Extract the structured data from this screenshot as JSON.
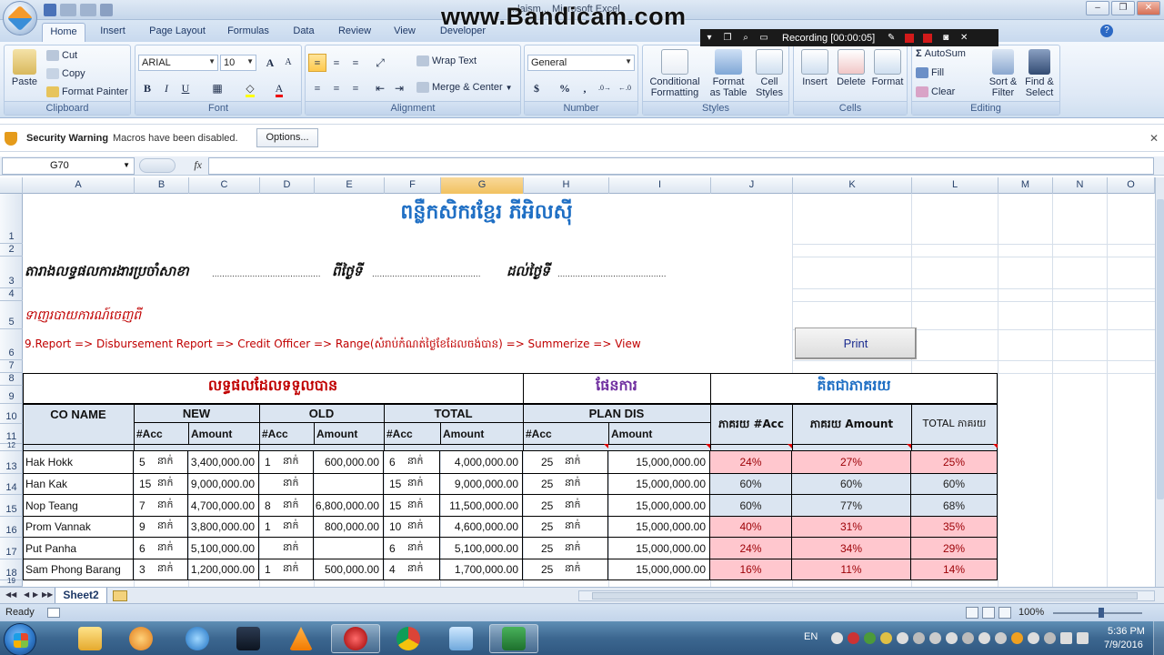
{
  "window": {
    "title": "...laism... Microsoft Excel",
    "watermark": "www.Bandicam.com"
  },
  "recorder": {
    "status": "Recording [00:00:05]"
  },
  "tabs": [
    "Home",
    "Insert",
    "Page Layout",
    "Formulas",
    "Data",
    "Review",
    "View",
    "Developer"
  ],
  "ribbon": {
    "clipboard": {
      "paste": "Paste",
      "cut": "Cut",
      "copy": "Copy",
      "format_painter": "Format Painter",
      "label": "Clipboard"
    },
    "font": {
      "name": "ARIAL",
      "size": "10",
      "bold": "B",
      "italic": "I",
      "underline": "U",
      "label": "Font"
    },
    "alignment": {
      "wrap_text": "Wrap Text",
      "merge_center": "Merge & Center",
      "label": "Alignment"
    },
    "number": {
      "format": "General",
      "currency": "$",
      "percent": "%",
      "comma": ",",
      "label": "Number"
    },
    "styles": {
      "conditional": "Conditional",
      "formatting": "Formatting",
      "format": "Format",
      "as_table": "as Table",
      "cell": "Cell",
      "cell_styles": "Styles",
      "label": "Styles"
    },
    "cells": {
      "insert": "Insert",
      "delete": "Delete",
      "format": "Format",
      "label": "Cells"
    },
    "editing": {
      "autosum": "AutoSum",
      "fill": "Fill",
      "clear": "Clear",
      "sort": "Sort &",
      "filter": "Filter",
      "find": "Find &",
      "select": "Select",
      "label": "Editing"
    }
  },
  "security": {
    "title": "Security Warning",
    "message": "Macros have been disabled.",
    "options": "Options..."
  },
  "formula_bar": {
    "name_box": "G70",
    "fx": "fx",
    "value": ""
  },
  "columns": [
    "A",
    "B",
    "C",
    "D",
    "E",
    "F",
    "G",
    "H",
    "I",
    "J",
    "K",
    "L",
    "M",
    "N",
    "O"
  ],
  "rows": [
    "1",
    "2",
    "3",
    "4",
    "5",
    "6",
    "7",
    "8",
    "9",
    "10",
    "11",
    "12",
    "13",
    "14",
    "15",
    "16",
    "17",
    "18",
    "19"
  ],
  "sheet": {
    "title": "ពន្លឺកសិករខ្មែរ ភីអិលស៊ី",
    "report_line": "តារាងលទ្ធផលការងារប្រចាំសាខា",
    "from_label": "ពីថ្ងៃទី",
    "to_label": "ដល់ថ្ងៃទី",
    "dots": "...........................................",
    "note_label": "ទាញរបាយការណ៍ចេញពី",
    "path": "9.Report => Disbursement Report => Credit Officer => Range(សំរាប់កំណត់ថ្ងៃខែដែលចង់បាន) => Summerize => View",
    "print_button": "Print",
    "section_result": "លទ្ធផលដែលទទួលបាន",
    "section_plan": "ផែនការ",
    "section_pct": "គិតជាភាគរយ",
    "hdr_coname": "CO NAME",
    "hdr_new": "NEW",
    "hdr_old": "OLD",
    "hdr_total": "TOTAL",
    "hdr_plandis": "PLAN DIS",
    "hdr_acc": "#Acc",
    "hdr_amount": "Amount",
    "hdr_pct_acc": "ភាគរយ #Acc",
    "hdr_pct_amount": "ភាគរយ Amount",
    "hdr_pct_total": "TOTAL ភាគរយ",
    "unit": "នាក់",
    "rows": [
      {
        "name": "Hak Hokk",
        "new_acc": "5",
        "new_amt": "3,400,000.00",
        "old_acc": "1",
        "old_amt": "600,000.00",
        "tot_acc": "6",
        "tot_amt": "4,000,000.00",
        "plan_acc": "25",
        "plan_amt": "15,000,000.00",
        "pct_acc": "24%",
        "pct_amt": "27%",
        "pct_tot": "25%",
        "pink": true
      },
      {
        "name": "Han Kak",
        "new_acc": "15",
        "new_amt": "9,000,000.00",
        "old_acc": "",
        "old_amt": "",
        "tot_acc": "15",
        "tot_amt": "9,000,000.00",
        "plan_acc": "25",
        "plan_amt": "15,000,000.00",
        "pct_acc": "60%",
        "pct_amt": "60%",
        "pct_tot": "60%",
        "pink": false
      },
      {
        "name": "Nop Teang",
        "new_acc": "7",
        "new_amt": "4,700,000.00",
        "old_acc": "8",
        "old_amt": "6,800,000.00",
        "tot_acc": "15",
        "tot_amt": "11,500,000.00",
        "plan_acc": "25",
        "plan_amt": "15,000,000.00",
        "pct_acc": "60%",
        "pct_amt": "77%",
        "pct_tot": "68%",
        "pink": false
      },
      {
        "name": "Prom Vannak",
        "new_acc": "9",
        "new_amt": "3,800,000.00",
        "old_acc": "1",
        "old_amt": "800,000.00",
        "tot_acc": "10",
        "tot_amt": "4,600,000.00",
        "plan_acc": "25",
        "plan_amt": "15,000,000.00",
        "pct_acc": "40%",
        "pct_amt": "31%",
        "pct_tot": "35%",
        "pink": true
      },
      {
        "name": "Put Panha",
        "new_acc": "6",
        "new_amt": "5,100,000.00",
        "old_acc": "",
        "old_amt": "",
        "tot_acc": "6",
        "tot_amt": "5,100,000.00",
        "plan_acc": "25",
        "plan_amt": "15,000,000.00",
        "pct_acc": "24%",
        "pct_amt": "34%",
        "pct_tot": "29%",
        "pink": true
      },
      {
        "name": "Sam Phong Barang",
        "new_acc": "3",
        "new_amt": "1,200,000.00",
        "old_acc": "1",
        "old_amt": "500,000.00",
        "tot_acc": "4",
        "tot_amt": "1,700,000.00",
        "plan_acc": "25",
        "plan_amt": "15,000,000.00",
        "pct_acc": "16%",
        "pct_amt": "11%",
        "pct_tot": "14%",
        "pink": true
      }
    ]
  },
  "sheet_tabs": [
    "Sheet2"
  ],
  "status": {
    "ready": "Ready",
    "zoom": "100%"
  },
  "taskbar": {
    "lang": "EN",
    "time": "5:36 PM",
    "date": "7/9/2016"
  },
  "colors": {
    "title_blue": "#1f6fc4",
    "khmer_red": "#c00000",
    "purple": "#7030a0",
    "pink_fill": "#ffc7ce",
    "blue_fill": "#dbe5f1"
  }
}
